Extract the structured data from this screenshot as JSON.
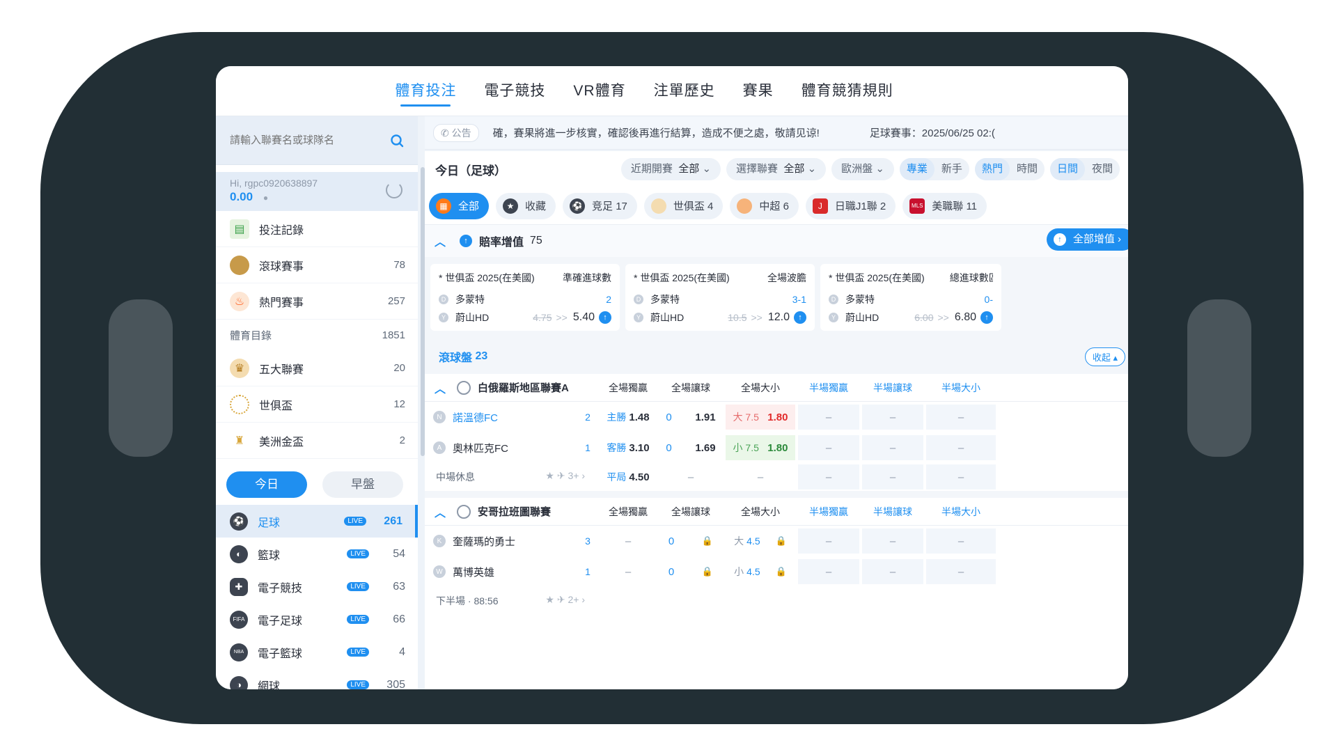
{
  "nav": {
    "tabs": [
      "體育投注",
      "電子競技",
      "VR體育",
      "注單歷史",
      "賽果",
      "體育競猜規則"
    ]
  },
  "search": {
    "placeholder": "請輸入聯賽名或球隊名"
  },
  "user": {
    "greeting": "Hi, rgpc0920638897",
    "balance": "0.00"
  },
  "menu": {
    "bet_record": "投注記錄",
    "items": [
      {
        "label": "滾球賽事",
        "count": "78"
      },
      {
        "label": "熱門賽事",
        "count": "257"
      }
    ],
    "catalog": {
      "label": "體育目錄",
      "count": "1851"
    },
    "leagues": [
      {
        "label": "五大聯賽",
        "count": "20"
      },
      {
        "label": "世俱盃",
        "count": "12"
      },
      {
        "label": "美洲金盃",
        "count": "2"
      }
    ]
  },
  "day": {
    "today": "今日",
    "early": "早盤"
  },
  "sports": [
    {
      "label": "足球",
      "live": "LIVE",
      "count": "261"
    },
    {
      "label": "籃球",
      "live": "LIVE",
      "count": "54"
    },
    {
      "label": "電子競技",
      "live": "LIVE",
      "count": "63"
    },
    {
      "label": "電子足球",
      "live": "LIVE",
      "count": "66"
    },
    {
      "label": "電子籃球",
      "live": "LIVE",
      "count": "4"
    },
    {
      "label": "網球",
      "live": "LIVE",
      "count": "305"
    }
  ],
  "notice": {
    "tag": "公告",
    "text": "確，賽果將進一步核實，確認後再進行結算，造成不便之處，敬請见谅!",
    "match": "足球賽事：2025/06/25 02:("
  },
  "filter": {
    "title": "今日（足球）",
    "recent": "近期開賽",
    "recent_val": "全部",
    "league": "選擇聯賽",
    "league_val": "全部",
    "odds": "歐洲盤",
    "t1": [
      "專業",
      "新手"
    ],
    "t2": [
      "熱門",
      "時間"
    ],
    "t3": [
      "日間",
      "夜間"
    ]
  },
  "chips": [
    {
      "label": "全部"
    },
    {
      "label": "收藏"
    },
    {
      "label": "竞足 17"
    },
    {
      "label": "世俱盃 4"
    },
    {
      "label": "中超 6"
    },
    {
      "label": "日職J1聯 2"
    },
    {
      "label": "美職聯 11"
    }
  ],
  "boost": {
    "title": "賠率增值",
    "count": "75",
    "all": "全部增值",
    "cards": [
      {
        "league": "* 世俱盃 2025(在美國)",
        "market": "準確進球數",
        "home": "多蒙特",
        "away": "蔚山HD",
        "pick": "2",
        "old": "4.75",
        "arrow": ">>",
        "new": "5.40"
      },
      {
        "league": "* 世俱盃 2025(在美國)",
        "market": "全場波膽",
        "home": "多蒙特",
        "away": "蔚山HD",
        "pick": "3-1",
        "old": "10.5",
        "arrow": ">>",
        "new": "12.0"
      },
      {
        "league": "* 世俱盃 2025(在美國)",
        "market": "總進球數區間",
        "home": "多蒙特",
        "away": "蔚山HD",
        "pick": "0-",
        "old": "6.00",
        "arrow": ">>",
        "new": "6.80"
      }
    ]
  },
  "live": {
    "title": "滾球盤",
    "count": "23",
    "collapse": "收起"
  },
  "cols": [
    "全場獨贏",
    "全場讓球",
    "全場大小",
    "半場獨贏",
    "半場讓球",
    "半場大小"
  ],
  "leagues": [
    {
      "name": "白俄羅斯地區聯賽A",
      "home": {
        "letter": "N",
        "name": "諾溫德FC",
        "score": "2",
        "ml_k": "主勝",
        "ml_v": "1.48",
        "hc": "0",
        "hc_v": "1.91",
        "ou_k": "大 7.5",
        "ou_v": "1.80"
      },
      "away": {
        "letter": "A",
        "name": "奧林匹克FC",
        "score": "1",
        "ml_k": "客勝",
        "ml_v": "3.10",
        "hc": "0",
        "hc_v": "1.69",
        "ou_k": "小 7.5",
        "ou_v": "1.80"
      },
      "status": "中場休息",
      "more": "3+",
      "draw_k": "平局",
      "draw_v": "4.50",
      "dash": "–"
    },
    {
      "name": "安哥拉班圖聯賽",
      "home": {
        "letter": "K",
        "name": "奎薩瑪的勇士",
        "score": "3",
        "hc": "0",
        "ou_k": "大",
        "ou_v": "4.5"
      },
      "away": {
        "letter": "W",
        "name": "萬博英雄",
        "score": "1",
        "hc": "0",
        "ou_k": "小",
        "ou_v": "4.5"
      },
      "status": "下半場 · 88:56",
      "more": "2+",
      "dash": "–"
    }
  ]
}
